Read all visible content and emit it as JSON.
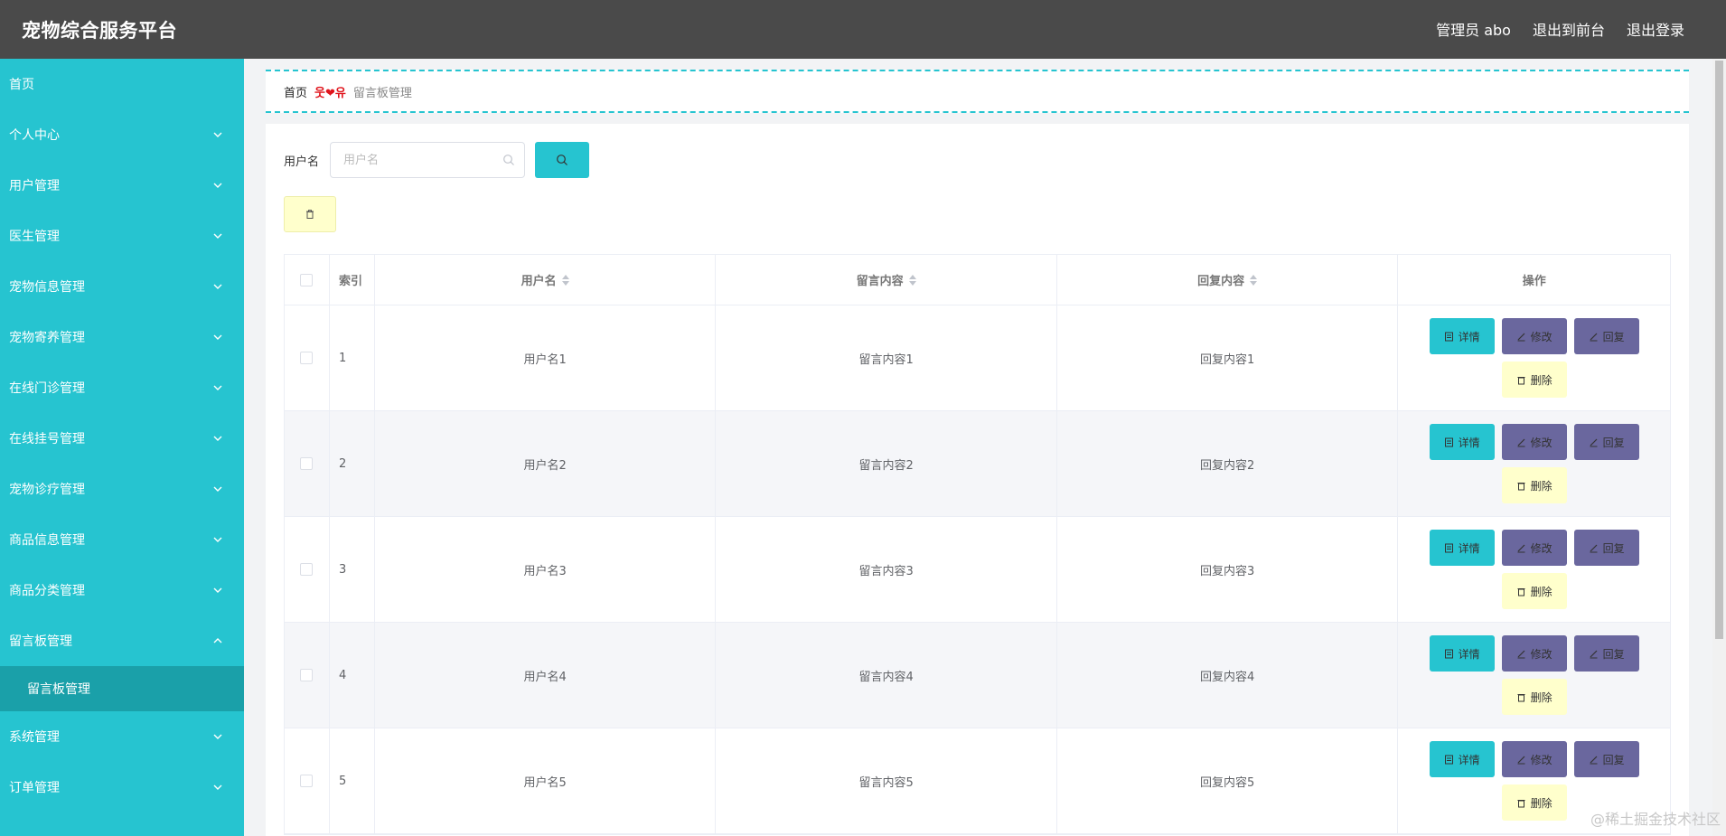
{
  "header": {
    "title": "宠物综合服务平台",
    "user": "管理员 abo",
    "front": "退出到前台",
    "logout": "退出登录"
  },
  "sidebar": {
    "items": [
      {
        "label": "首页"
      },
      {
        "label": "个人中心"
      },
      {
        "label": "用户管理"
      },
      {
        "label": "医生管理"
      },
      {
        "label": "宠物信息管理"
      },
      {
        "label": "宠物寄养管理"
      },
      {
        "label": "在线门诊管理"
      },
      {
        "label": "在线挂号管理"
      },
      {
        "label": "宠物诊疗管理"
      },
      {
        "label": "商品信息管理"
      },
      {
        "label": "商品分类管理"
      },
      {
        "label": "留言板管理"
      },
      {
        "label": "系统管理"
      },
      {
        "label": "订单管理"
      }
    ],
    "sub_active": "留言板管理"
  },
  "breadcrumb": {
    "home": "首页",
    "sep": "웃❤유",
    "current": "留言板管理"
  },
  "search": {
    "label": "用户名",
    "placeholder": "用户名",
    "value": ""
  },
  "table": {
    "headers": {
      "index": "索引",
      "user": "用户名",
      "message": "留言内容",
      "reply": "回复内容",
      "ops": "操作"
    },
    "rows": [
      {
        "index": "1",
        "user": "用户名1",
        "message": "留言内容1",
        "reply": "回复内容1"
      },
      {
        "index": "2",
        "user": "用户名2",
        "message": "留言内容2",
        "reply": "回复内容2"
      },
      {
        "index": "3",
        "user": "用户名3",
        "message": "留言内容3",
        "reply": "回复内容3"
      },
      {
        "index": "4",
        "user": "用户名4",
        "message": "留言内容4",
        "reply": "回复内容4"
      },
      {
        "index": "5",
        "user": "用户名5",
        "message": "留言内容5",
        "reply": "回复内容5"
      }
    ],
    "buttons": {
      "detail": "详情",
      "edit": "修改",
      "reply": "回复",
      "delete": "删除"
    }
  },
  "watermark": "@稀土掘金技术社区",
  "colors": {
    "accent": "#26c4d0",
    "accent_dark": "#1aa0a9",
    "header_bg": "#4a4a4a",
    "purple": "#6a679e",
    "pale_yellow": "#ffffcc"
  },
  "icons": {
    "chevron": "chevron-down-icon",
    "chevron_up": "chevron-up-icon",
    "search": "search-icon",
    "trash": "trash-icon",
    "document": "document-icon",
    "edit": "edit-icon"
  }
}
